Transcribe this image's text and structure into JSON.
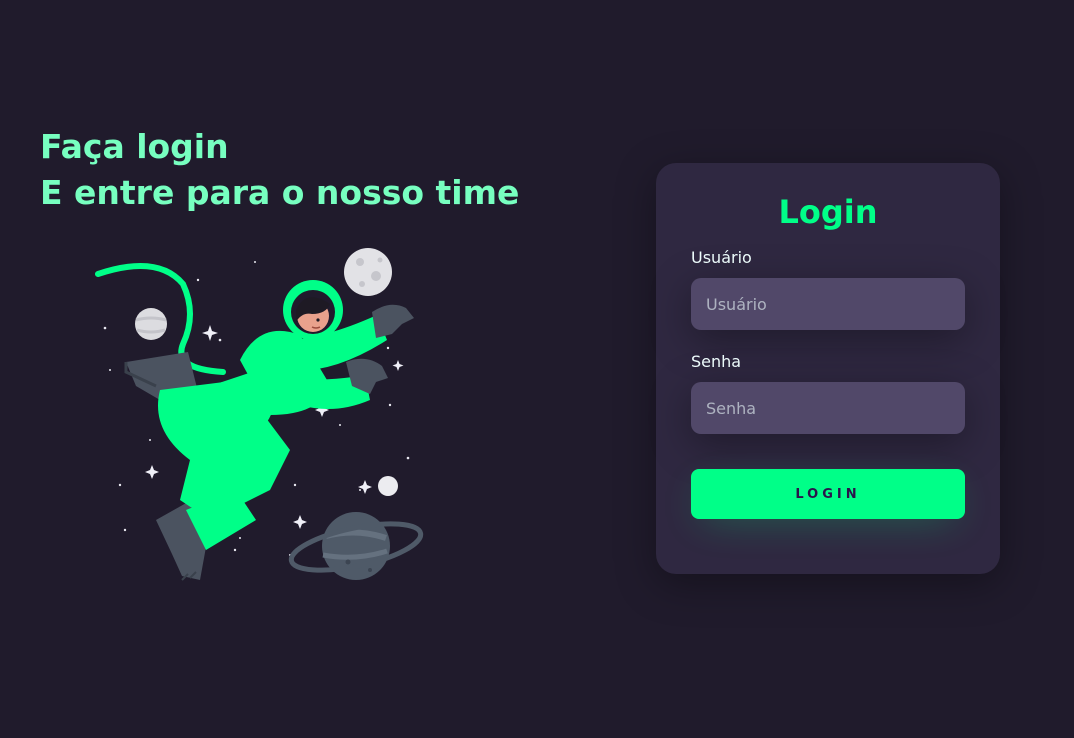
{
  "hero": {
    "line1": "Faça login",
    "line2": "E entre para o nosso time"
  },
  "illustration": {
    "icon": "astronaut-illustration",
    "accent_color": "#00ff88"
  },
  "login_card": {
    "title": "Login",
    "username": {
      "label": "Usuário",
      "placeholder": "Usuário",
      "value": ""
    },
    "password": {
      "label": "Senha",
      "placeholder": "Senha",
      "value": ""
    },
    "submit_label": "LOGIN"
  },
  "colors": {
    "background": "#201b2c",
    "card": "#2f2841",
    "input": "#514869",
    "accent": "#00ff88",
    "headline": "#77ffc0"
  }
}
